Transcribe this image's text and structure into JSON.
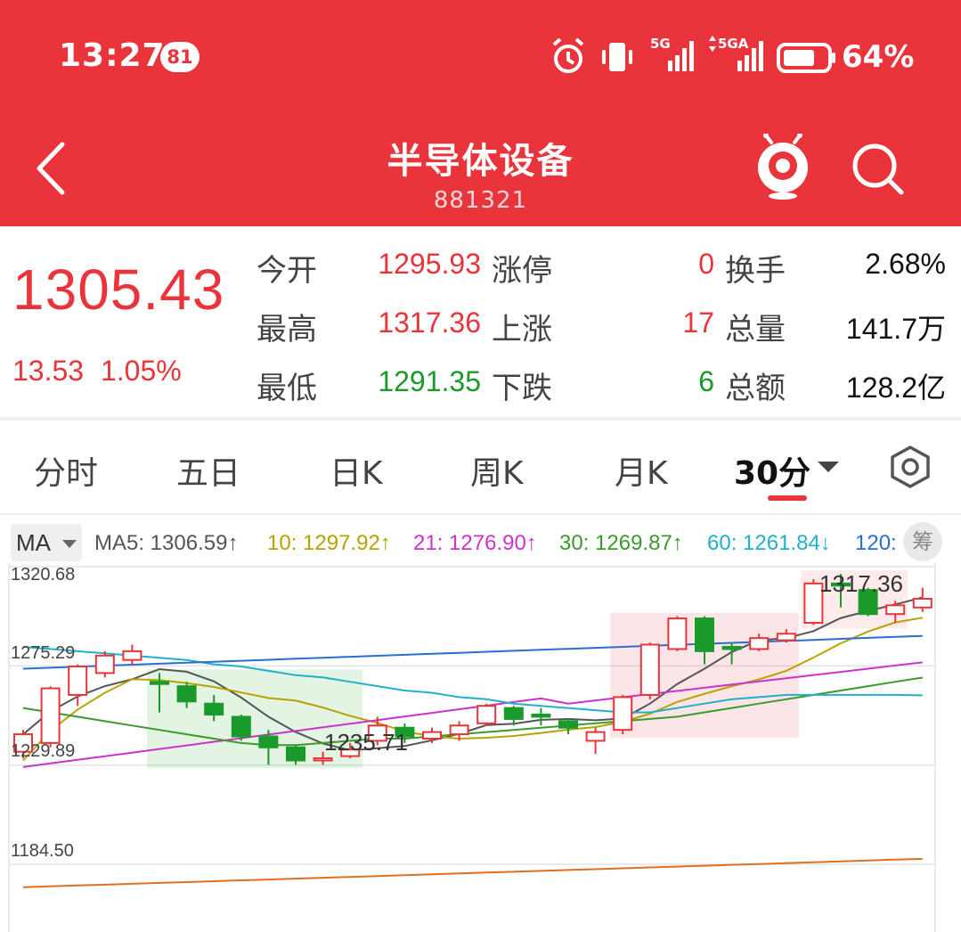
{
  "status": {
    "time": "13:27",
    "badge": "81",
    "net1": "5G",
    "net2": "5GA",
    "battery": "64%"
  },
  "header": {
    "title": "半导体设备",
    "code": "881321"
  },
  "quote": {
    "price": "1305.43",
    "change": "13.53",
    "change_pct": "1.05%",
    "open_label": "今开",
    "open": "1295.93",
    "high_label": "最高",
    "high": "1317.36",
    "low_label": "最低",
    "low": "1291.35",
    "limit_up_label": "涨停",
    "limit_up": "0",
    "up_label": "上涨",
    "up": "17",
    "down_label": "下跌",
    "down": "6",
    "turnover_label": "换手",
    "turnover": "2.68%",
    "volume_label": "总量",
    "volume": "141.7万",
    "amount_label": "总额",
    "amount": "128.2亿"
  },
  "tabs": [
    {
      "label": "分时"
    },
    {
      "label": "五日"
    },
    {
      "label": "日K"
    },
    {
      "label": "周K"
    },
    {
      "label": "月K"
    },
    {
      "label": "30分"
    }
  ],
  "ma": {
    "selector": "MA",
    "items": [
      {
        "text": "MA5: 1306.59↑",
        "color": "#555555"
      },
      {
        "text": "10: 1297.92↑",
        "color": "#b8a200"
      },
      {
        "text": "21: 1276.90↑",
        "color": "#cc33cc"
      },
      {
        "text": "30: 1269.87↑",
        "color": "#3a9a2a"
      },
      {
        "text": "60: 1261.84↓",
        "color": "#22b0c8"
      },
      {
        "text": "120:",
        "color": "#2a6fd0"
      }
    ],
    "chip": "筹"
  },
  "colors": {
    "up": "#e8343a",
    "down": "#1a9a2a",
    "ma5": "#555555",
    "ma10": "#b8a200",
    "ma21": "#cc33cc",
    "ma30": "#3a9a2a",
    "ma60": "#22b0c8",
    "ma120": "#2a6fd0",
    "ma250": "#e07020"
  },
  "chart_data": {
    "type": "candlestick",
    "y_ticks": [
      "1320.68",
      "1275.29",
      "1229.89",
      "1184.50"
    ],
    "ylim": [
      1184.5,
      1320.68
    ],
    "annotations": {
      "high": "1317.36",
      "low": "1235.71"
    },
    "candles": [
      {
        "o": 1236,
        "c": 1244,
        "h": 1246,
        "l": 1233
      },
      {
        "o": 1240,
        "c": 1265,
        "h": 1266,
        "l": 1238
      },
      {
        "o": 1262,
        "c": 1275,
        "h": 1276,
        "l": 1257
      },
      {
        "o": 1272,
        "c": 1280,
        "h": 1282,
        "l": 1270
      },
      {
        "o": 1278,
        "c": 1282,
        "h": 1285,
        "l": 1276
      },
      {
        "o": 1268,
        "c": 1267,
        "h": 1272,
        "l": 1254
      },
      {
        "o": 1266,
        "c": 1259,
        "h": 1268,
        "l": 1256
      },
      {
        "o": 1258,
        "c": 1253,
        "h": 1262,
        "l": 1250
      },
      {
        "o": 1252,
        "c": 1243,
        "h": 1253,
        "l": 1241
      },
      {
        "o": 1243,
        "c": 1238,
        "h": 1246,
        "l": 1230
      },
      {
        "o": 1238,
        "c": 1232,
        "h": 1239,
        "l": 1230
      },
      {
        "o": 1232,
        "c": 1233,
        "h": 1236,
        "l": 1230
      },
      {
        "o": 1234,
        "c": 1237,
        "h": 1240,
        "l": 1233
      },
      {
        "o": 1241,
        "c": 1248,
        "h": 1252,
        "l": 1239
      },
      {
        "o": 1247,
        "c": 1243,
        "h": 1249,
        "l": 1240
      },
      {
        "o": 1242,
        "c": 1245,
        "h": 1247,
        "l": 1240
      },
      {
        "o": 1244,
        "c": 1248,
        "h": 1250,
        "l": 1241
      },
      {
        "o": 1249,
        "c": 1257,
        "h": 1258,
        "l": 1248
      },
      {
        "o": 1256,
        "c": 1251,
        "h": 1257,
        "l": 1248
      },
      {
        "o": 1253,
        "c": 1252,
        "h": 1256,
        "l": 1248
      },
      {
        "o": 1250,
        "c": 1247,
        "h": 1251,
        "l": 1244
      },
      {
        "o": 1241,
        "c": 1245,
        "h": 1247,
        "l": 1235
      },
      {
        "o": 1246,
        "c": 1261,
        "h": 1262,
        "l": 1244
      },
      {
        "o": 1262,
        "c": 1285,
        "h": 1286,
        "l": 1260
      },
      {
        "o": 1283,
        "c": 1297,
        "h": 1298,
        "l": 1282
      },
      {
        "o": 1297,
        "c": 1282,
        "h": 1298,
        "l": 1276
      },
      {
        "o": 1284,
        "c": 1283,
        "h": 1286,
        "l": 1276
      },
      {
        "o": 1283,
        "c": 1288,
        "h": 1290,
        "l": 1282
      },
      {
        "o": 1287,
        "c": 1290,
        "h": 1292,
        "l": 1286
      },
      {
        "o": 1295,
        "c": 1313,
        "h": 1315,
        "l": 1294
      },
      {
        "o": 1313,
        "c": 1312,
        "h": 1317.36,
        "l": 1302
      },
      {
        "o": 1310,
        "c": 1299,
        "h": 1311,
        "l": 1298
      },
      {
        "o": 1299,
        "c": 1303,
        "h": 1305,
        "l": 1295
      },
      {
        "o": 1302,
        "c": 1306,
        "h": 1311,
        "l": 1300
      }
    ]
  }
}
